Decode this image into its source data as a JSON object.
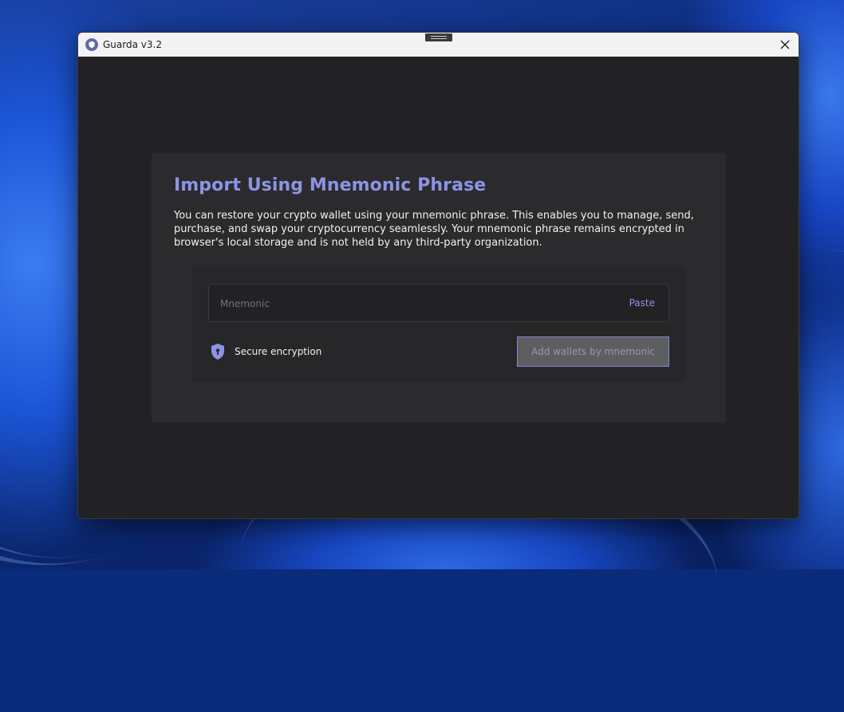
{
  "window": {
    "title": "Guarda v3.2"
  },
  "card": {
    "title": "Import Using Mnemonic Phrase",
    "description": "You can restore your crypto wallet using your mnemonic phrase. This enables you to manage, send, purchase, and swap your cryptocurrency seamlessly. Your mnemonic phrase remains encrypted in browser's local storage and is not held by any third-party organization."
  },
  "mnemonic_input": {
    "placeholder": "Mnemonic",
    "value": "",
    "paste_label": "Paste"
  },
  "security": {
    "label": "Secure encryption",
    "icon": "shield-lock-icon"
  },
  "actions": {
    "add_wallets_label": "Add wallets by mnemonic",
    "enabled": false
  },
  "colors": {
    "accent": "#8d93e4",
    "window_bg": "#222224",
    "card_bg": "#2b2b2e",
    "titlebar_bg": "#f3f3f3"
  }
}
